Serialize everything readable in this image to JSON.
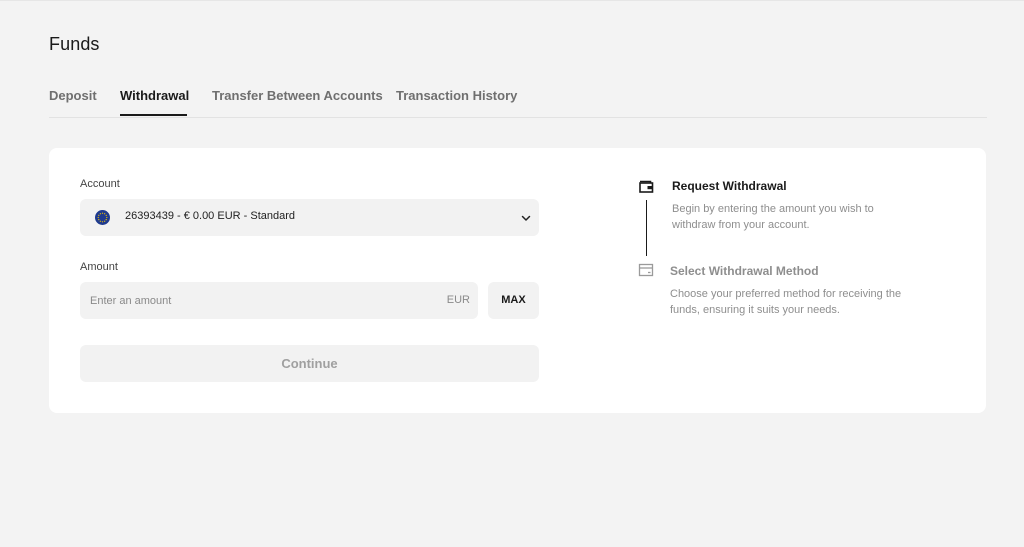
{
  "page": {
    "title": "Funds"
  },
  "tabs": [
    {
      "label": "Deposit",
      "active": false
    },
    {
      "label": "Withdrawal",
      "active": true
    },
    {
      "label": "Transfer Between Accounts",
      "active": false
    },
    {
      "label": "Transaction History",
      "active": false
    }
  ],
  "form": {
    "account_label": "Account",
    "account_selected": "26393439 - € 0.00 EUR - Standard",
    "amount_label": "Amount",
    "amount_value": "",
    "amount_placeholder": "Enter an amount",
    "currency": "EUR",
    "max_label": "MAX",
    "continue_label": "Continue",
    "continue_disabled": true
  },
  "steps": [
    {
      "title": "Request Withdrawal",
      "description": "Begin by entering the amount you wish to withdraw from your account.",
      "active": true,
      "icon": "wallet-icon"
    },
    {
      "title": "Select Withdrawal Method",
      "description": "Choose your preferred method for receiving the funds, ensuring it suits your needs.",
      "active": false,
      "icon": "card-icon"
    }
  ],
  "colors": {
    "background": "#f3f3f3",
    "card": "#ffffff",
    "field": "#f2f2f2",
    "text_primary": "#1a1a1a",
    "text_muted": "#8e8e8e",
    "flag_blue": "#1f3b8f",
    "flag_stars": "#f5c400"
  }
}
